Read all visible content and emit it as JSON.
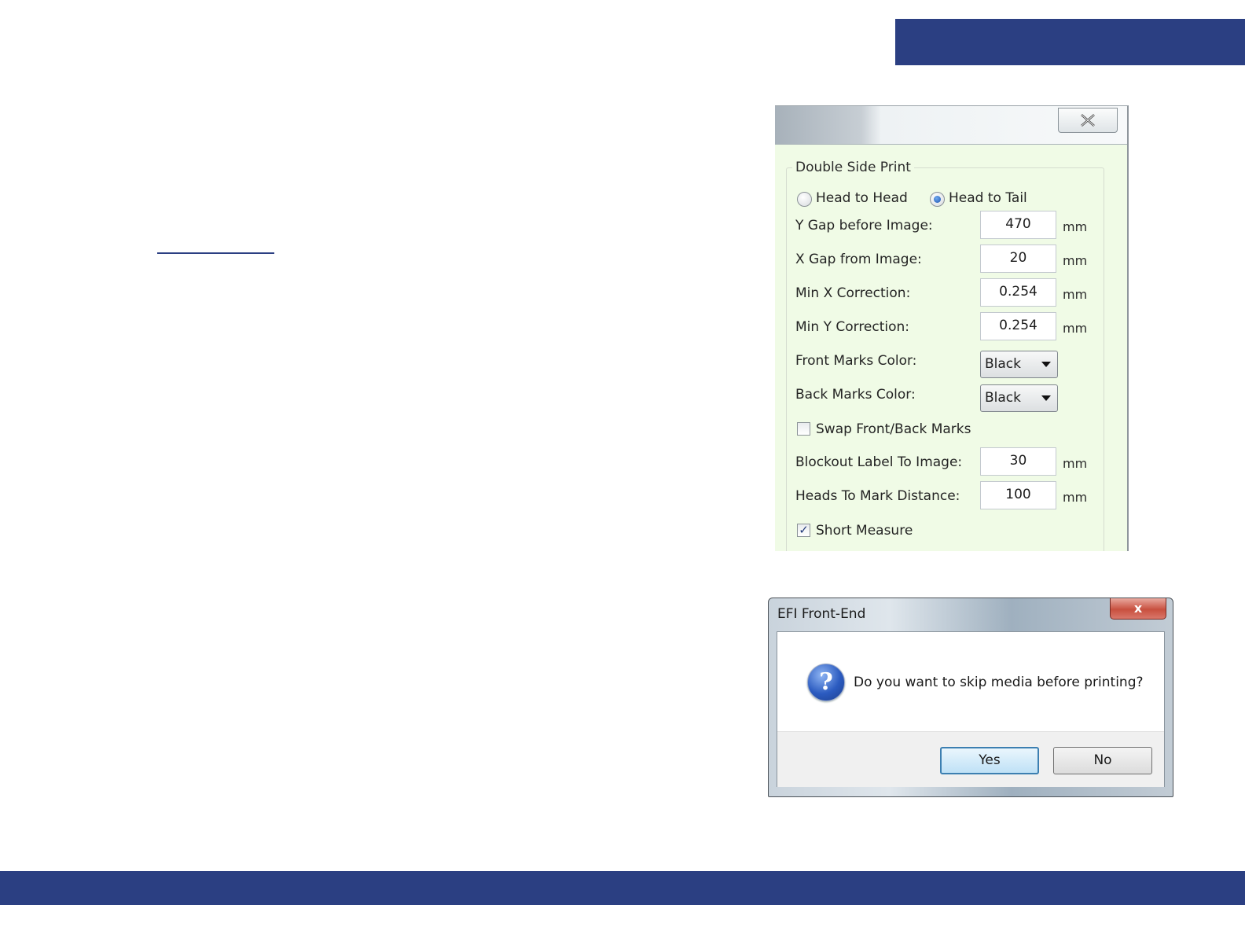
{
  "colors": {
    "brand_bar": "#2b3f82",
    "dialog_bg": "#f0fbe6"
  },
  "settings_dialog": {
    "close_icon": "close-icon",
    "group_title": "Double Side Print",
    "radio_head_to_head": "Head to Head",
    "radio_head_to_tail": "Head to Tail",
    "selected_mode": "Head to Tail",
    "unit": "mm",
    "fields": [
      {
        "label": "Y Gap before Image:",
        "value": "470"
      },
      {
        "label": "X Gap from Image:",
        "value": "20"
      },
      {
        "label": "Min X Correction:",
        "value": "0.254"
      },
      {
        "label": "Min Y Correction:",
        "value": "0.254"
      }
    ],
    "front_marks_label": "Front Marks Color:",
    "front_marks_value": "Black",
    "back_marks_label": "Back Marks Color:",
    "back_marks_value": "Black",
    "swap_label": "Swap Front/Back Marks",
    "swap_checked": false,
    "blockout_label": "Blockout Label To Image:",
    "blockout_value": "30",
    "heads_label": "Heads To Mark Distance:",
    "heads_value": "100",
    "short_measure_label": "Short Measure",
    "short_measure_checked": true
  },
  "message_box": {
    "title": "EFI Front-End",
    "close_label": "x",
    "icon": "question-icon",
    "message": "Do you want to skip media before printing?",
    "yes_label": "Yes",
    "no_label": "No"
  }
}
